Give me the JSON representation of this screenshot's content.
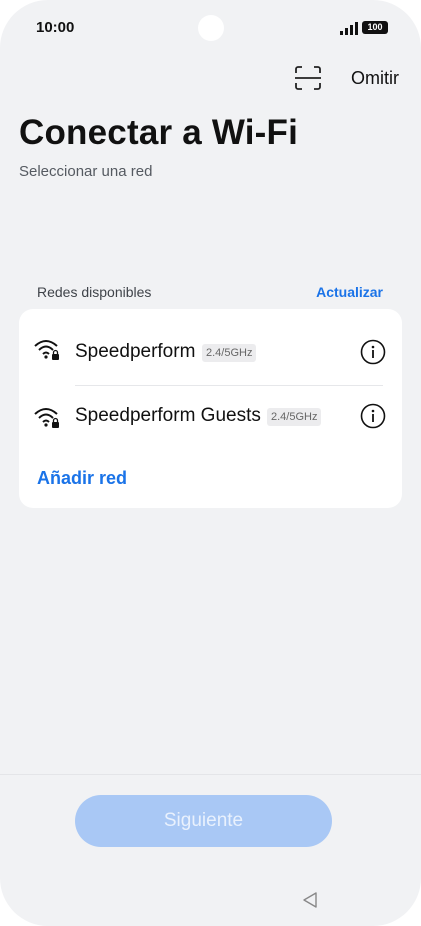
{
  "status_bar": {
    "time": "10:00",
    "battery": "100"
  },
  "header": {
    "skip_label": "Omitir",
    "title": "Conectar a Wi-Fi",
    "subtitle": "Seleccionar una red"
  },
  "networks_section": {
    "label": "Redes disponibles",
    "refresh_label": "Actualizar",
    "networks": [
      {
        "name": "Speedperform",
        "band": "2.4/5GHz",
        "icon": "wifi-secured-icon"
      },
      {
        "name": "Speedperform Guests",
        "band": "2.4/5GHz",
        "icon": "wifi-secured-icon"
      }
    ],
    "add_network_label": "Añadir red"
  },
  "footer": {
    "next_label": "Siguiente"
  },
  "colors": {
    "accent": "#1a73e8",
    "background": "#f1f2f4",
    "button_disabled": "#a9c8f5"
  }
}
